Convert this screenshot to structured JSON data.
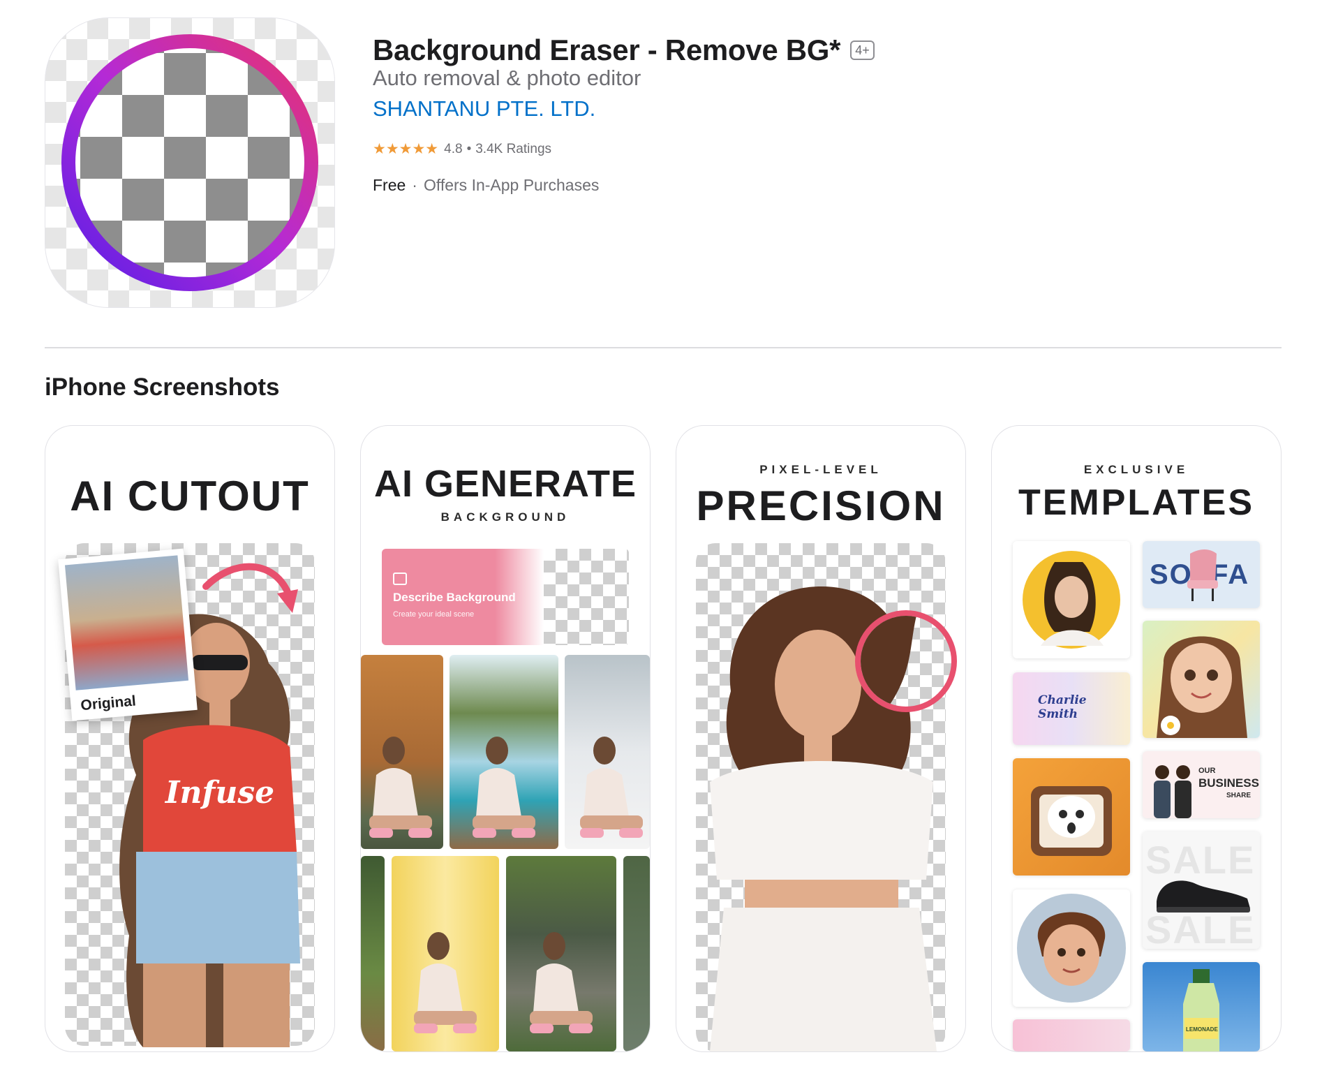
{
  "app": {
    "title": "Background Eraser - Remove BG*",
    "age_rating": "4+",
    "subtitle": "Auto removal & photo editor",
    "developer": "SHANTANU PTE. LTD.",
    "rating": {
      "stars_glyphs": "★★★★★",
      "value": "4.8",
      "separator": "•",
      "count": "3.4K Ratings"
    },
    "price": "Free",
    "price_separator": "·",
    "in_app": "Offers In-App Purchases"
  },
  "section": {
    "title": "iPhone Screenshots"
  },
  "screenshots": [
    {
      "headline": "AI CUTOUT",
      "caption": "Original",
      "shirt_text": "Infuse"
    },
    {
      "headline": "AI GENERATE",
      "kicker": "BACKGROUND",
      "prompt_title": "Describe Background",
      "prompt_subtitle": "Create your ideal scene"
    },
    {
      "kicker": "PIXEL-LEVEL",
      "headline": "PRECISION"
    },
    {
      "kicker": "EXCLUSIVE",
      "headline": "TEMPLATES",
      "tpl_sofa": "SO  FA",
      "tpl_name": "Charlie Smith",
      "tpl_business_top": "OUR",
      "tpl_business": "BUSINESS",
      "tpl_business_share": "SHARE",
      "tpl_sale": "SALE",
      "tpl_lemonade": "LEMONADE"
    }
  ],
  "colors": {
    "accent_link": "#0070c9",
    "stars": "#f09a37",
    "ring_start": "#e8336d",
    "ring_end": "#5a1ee6",
    "zoom_ring": "#e8506e",
    "prompt_pink": "#ee8aa0"
  }
}
